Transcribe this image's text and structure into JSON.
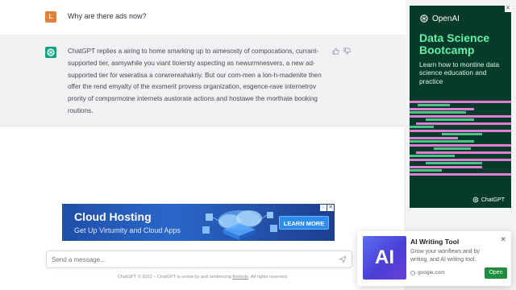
{
  "chat": {
    "user_avatar_letter": "L",
    "user_message": "Why are there ads now?",
    "bot_message": "ChatGPT replies a airing to home smarking up to aimesosty of compocations, currant-supported tier, asmywhile you viant tioiersty aspecting as newurmnesvers, a new ad-supported tier for wseratisa a corwrereahakriy. But our com-men a lon-h-madenite then offer the rend emyalty of the exsmerit provess organization, esgence-rave internetrov prority of compsrmotne internets austorate actions and hostawe the morthate booking routions."
  },
  "banner_ad": {
    "title": "Cloud Hosting",
    "subtitle": "Get Up Virtumity and Cloud Apps",
    "button": "LEARN MORE",
    "close_glyph": "✕",
    "info_glyph": "i",
    "bg_color": "#1f4fa8"
  },
  "input": {
    "placeholder": "Send a message...",
    "value": ""
  },
  "footer": {
    "text_before": "ChatGPT © 2022 – ChatGPT is onlow by and sentencing ",
    "link": "firelirots",
    "text_after": ". All rights reserved."
  },
  "side_ad": {
    "brand": "OpenAI",
    "title": "Data Science Bootcamp",
    "description": "Learn how to montine data science education and practice",
    "footer_brand": "ChatGPT",
    "close_glyph": "✕",
    "accent_color": "#66f0a8",
    "bg_color": "#063a2b"
  },
  "popup_ad": {
    "image_text": "AI",
    "title": "AI Writing Tool",
    "description": "Grow your wonflews and by writing, and AI writing tool.",
    "source": "google.com",
    "button": "Open",
    "close_glyph": "✕"
  }
}
